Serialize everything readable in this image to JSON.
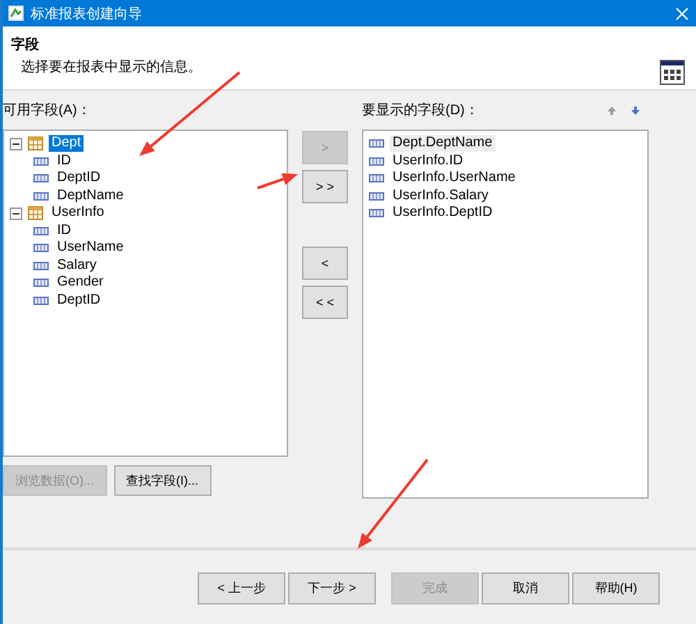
{
  "window": {
    "title": "标准报表创建向导"
  },
  "header": {
    "title": "字段",
    "subtitle": "选择要在报表中显示的信息。"
  },
  "available": {
    "label": "可用字段(A)：",
    "tree": [
      {
        "label": "Dept",
        "selected": true,
        "expanded": true,
        "children": [
          {
            "label": "ID",
            "selected": false
          },
          {
            "label": "DeptID",
            "selected": false
          },
          {
            "label": "DeptName",
            "selected": false
          }
        ]
      },
      {
        "label": "UserInfo",
        "selected": false,
        "expanded": true,
        "children": [
          {
            "label": "ID",
            "selected": false
          },
          {
            "label": "UserName",
            "selected": false
          },
          {
            "label": "Salary",
            "selected": false
          },
          {
            "label": "Gender",
            "selected": false
          },
          {
            "label": "DeptID",
            "selected": false
          }
        ]
      }
    ]
  },
  "move_buttons": [
    {
      "label": ">",
      "disabled": true
    },
    {
      "label": "> >",
      "disabled": false
    },
    {
      "label": "<",
      "disabled": false
    },
    {
      "label": "< <",
      "disabled": false
    }
  ],
  "shown": {
    "label": "要显示的字段(D)：",
    "items": [
      {
        "label": "Dept.DeptName",
        "selected": true
      },
      {
        "label": "UserInfo.ID",
        "selected": false
      },
      {
        "label": "UserInfo.UserName",
        "selected": false
      },
      {
        "label": "UserInfo.Salary",
        "selected": false
      },
      {
        "label": "UserInfo.DeptID",
        "selected": false
      }
    ]
  },
  "list_buttons": [
    {
      "label": "浏览数据(O)...",
      "disabled": true
    },
    {
      "label": "查找字段(I)...",
      "disabled": false
    }
  ],
  "footer_buttons": [
    {
      "label": "< 上一步",
      "disabled": false
    },
    {
      "label": "下一步 >",
      "disabled": false
    },
    {
      "label": "完成",
      "disabled": true
    },
    {
      "label": "取消",
      "disabled": false
    },
    {
      "label": "帮助(H)",
      "disabled": false
    }
  ]
}
